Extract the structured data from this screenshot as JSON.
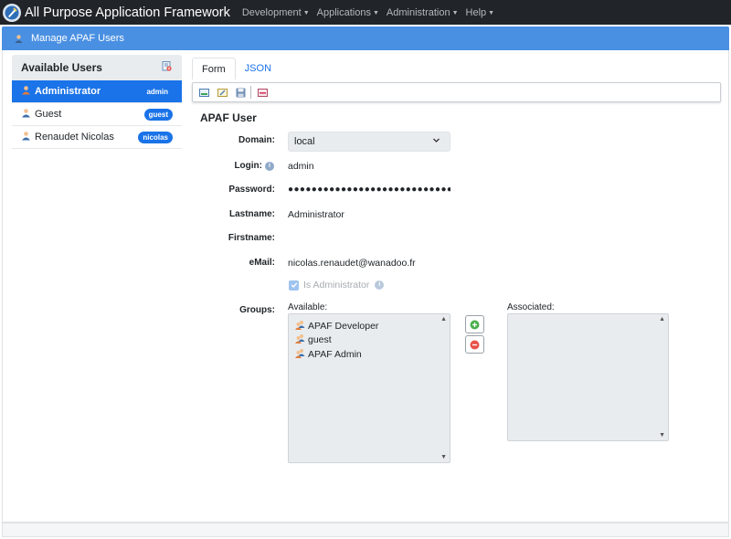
{
  "navbar": {
    "brand": "All Purpose Application Framework",
    "menu": [
      {
        "label": "Development"
      },
      {
        "label": "Applications"
      },
      {
        "label": "Administration"
      },
      {
        "label": "Help"
      }
    ]
  },
  "header": {
    "title": "Manage APAF Users"
  },
  "users": {
    "title": "Available Users",
    "items": [
      {
        "name": "Administrator",
        "badge": "admin",
        "active": true
      },
      {
        "name": "Guest",
        "badge": "guest",
        "active": false
      },
      {
        "name": "Renaudet Nicolas",
        "badge": "nicolas",
        "active": false
      }
    ]
  },
  "tabs": [
    {
      "label": "Form",
      "active": true
    },
    {
      "label": "JSON",
      "active": false
    }
  ],
  "form": {
    "section_title": "APAF User",
    "domain": {
      "label": "Domain:",
      "value": "local"
    },
    "login": {
      "label": "Login:",
      "value": "admin"
    },
    "password": {
      "label": "Password:",
      "value": "●●●●●●●●●●●●●●●●●●●●●●●●●●●●●●●●●●●"
    },
    "lastname": {
      "label": "Lastname:",
      "value": "Administrator"
    },
    "firstname": {
      "label": "Firstname:",
      "value": ""
    },
    "email": {
      "label": "eMail:",
      "value": "nicolas.renaudet@wanadoo.fr"
    },
    "is_admin": {
      "label": "Is Administrator",
      "checked": true
    },
    "groups": {
      "label": "Groups:",
      "available_label": "Available:",
      "associated_label": "Associated:",
      "available": [
        "APAF Developer",
        "guest",
        "APAF Admin"
      ],
      "associated": []
    }
  },
  "colors": {
    "navbar_bg": "#212529",
    "header_bg": "#4a90e2",
    "accent": "#1a73e8"
  }
}
